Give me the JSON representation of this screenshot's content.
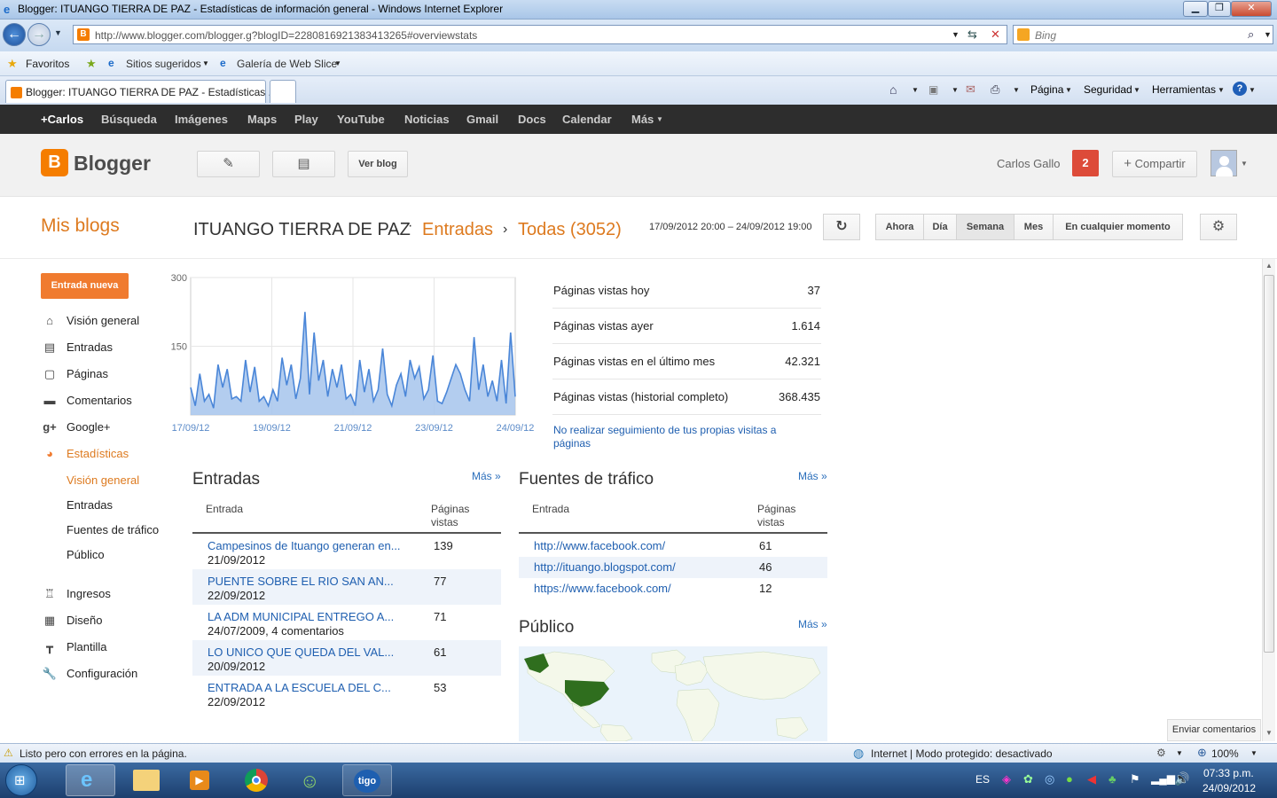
{
  "window": {
    "title": "Blogger: ITUANGO TIERRA DE PAZ - Estadísticas de información general - Windows Internet Explorer",
    "url": "http://www.blogger.com/blogger.g?blogID=2280816921383413265#overviewstats",
    "search_placeholder": "Bing"
  },
  "favorites": {
    "favorites_label": "Favoritos",
    "suggested_label": "Sitios sugeridos",
    "webslice_label": "Galería de Web Slice"
  },
  "tabs": [
    {
      "label": "Blogger: ITUANGO TIERRA DE PAZ - Estadísticas ..."
    }
  ],
  "command_bar": {
    "page": "Página",
    "security": "Seguridad",
    "tools": "Herramientas"
  },
  "google_bar": [
    "+Carlos",
    "Búsqueda",
    "Imágenes",
    "Maps",
    "Play",
    "YouTube",
    "Noticias",
    "Gmail",
    "Docs",
    "Calendar",
    "Más"
  ],
  "header": {
    "logo": "Blogger",
    "view_blog": "Ver blog",
    "user": "Carlos Gallo",
    "notifications": "2",
    "share": "Compartir"
  },
  "subheader": {
    "my_blogs": "Mis blogs",
    "blog_name": "ITUANGO TIERRA DE PAZ",
    "section": "Entradas",
    "filter": "Todas (3052)",
    "date_range": "17/09/2012 20:00 – 24/09/2012 19:00",
    "ranges": [
      "Ahora",
      "Día",
      "Semana",
      "Mes",
      "En cualquier momento"
    ],
    "selected_range": "Semana"
  },
  "sidebar": {
    "new_post": "Entrada nueva",
    "items": [
      {
        "label": "Visión general",
        "icon": "home-icon"
      },
      {
        "label": "Entradas",
        "icon": "posts-icon"
      },
      {
        "label": "Páginas",
        "icon": "pages-icon"
      },
      {
        "label": "Comentarios",
        "icon": "comments-icon"
      },
      {
        "label": "Google+",
        "icon": "google-plus-icon"
      },
      {
        "label": "Estadísticas",
        "icon": "stats-icon"
      }
    ],
    "stats_sub": [
      "Visión general",
      "Entradas",
      "Fuentes de tráfico",
      "Público"
    ],
    "items2": [
      {
        "label": "Ingresos",
        "icon": "trophy-icon"
      },
      {
        "label": "Diseño",
        "icon": "layout-icon"
      },
      {
        "label": "Plantilla",
        "icon": "template-icon"
      },
      {
        "label": "Configuración",
        "icon": "wrench-icon"
      }
    ]
  },
  "chart_data": {
    "type": "area",
    "ylim": [
      0,
      300
    ],
    "y_ticks": [
      "300",
      "150"
    ],
    "x_ticks": [
      "17/09/12",
      "19/09/12",
      "21/09/12",
      "23/09/12",
      "24/09/12"
    ],
    "color": "#a6c4ec",
    "values": [
      60,
      20,
      90,
      30,
      45,
      15,
      110,
      60,
      100,
      35,
      40,
      30,
      120,
      50,
      105,
      30,
      40,
      20,
      55,
      30,
      125,
      65,
      110,
      35,
      80,
      225,
      45,
      180,
      75,
      120,
      40,
      100,
      60,
      110,
      35,
      45,
      20,
      120,
      50,
      100,
      30,
      55,
      145,
      45,
      20,
      65,
      90,
      40,
      120,
      80,
      105,
      35,
      55,
      130,
      30,
      25,
      50,
      80,
      110,
      90,
      55,
      30,
      170,
      55,
      110,
      40,
      75,
      30,
      120,
      25,
      180,
      40
    ]
  },
  "stats": [
    {
      "label": "Páginas vistas hoy",
      "value": "37"
    },
    {
      "label": "Páginas vistas ayer",
      "value": "1.614"
    },
    {
      "label": "Páginas vistas en el último mes",
      "value": "42.321"
    },
    {
      "label": "Páginas vistas (historial completo)",
      "value": "368.435"
    }
  ],
  "no_track": "No realizar seguimiento de tus propias visitas a páginas",
  "posts": {
    "title": "Entradas",
    "more": "Más »",
    "col_entry": "Entrada",
    "col_views": "Páginas vistas",
    "rows": [
      {
        "title": "Campesinos de Ituango generan en...",
        "meta": "21/09/2012",
        "views": "139"
      },
      {
        "title": "PUENTE SOBRE EL RIO SAN AN...",
        "meta": "22/09/2012",
        "views": "77"
      },
      {
        "title": "LA ADM MUNICIPAL ENTREGO A...",
        "meta": "24/07/2009, 4 comentarios",
        "views": "71"
      },
      {
        "title": "LO UNICO QUE QUEDA DEL VAL...",
        "meta": "20/09/2012",
        "views": "61"
      },
      {
        "title": "ENTRADA A LA ESCUELA DEL C...",
        "meta": "22/09/2012",
        "views": "53"
      }
    ]
  },
  "traffic": {
    "title": "Fuentes de tráfico",
    "more": "Más »",
    "col_entry": "Entrada",
    "col_views": "Páginas vistas",
    "rows": [
      {
        "url": "http://www.facebook.com/",
        "views": "61"
      },
      {
        "url": "http://ituango.blogspot.com/",
        "views": "46"
      },
      {
        "url": "https://www.facebook.com/",
        "views": "12"
      }
    ]
  },
  "audience": {
    "title": "Público",
    "more": "Más »"
  },
  "feedback": "Enviar comentarios",
  "status": {
    "message": "Listo pero con errores en la página.",
    "zone": "Internet | Modo protegido: desactivado",
    "zoom": "100%"
  },
  "taskbar": {
    "lang": "ES",
    "time": "07:33 p.m.",
    "date": "24/09/2012"
  }
}
